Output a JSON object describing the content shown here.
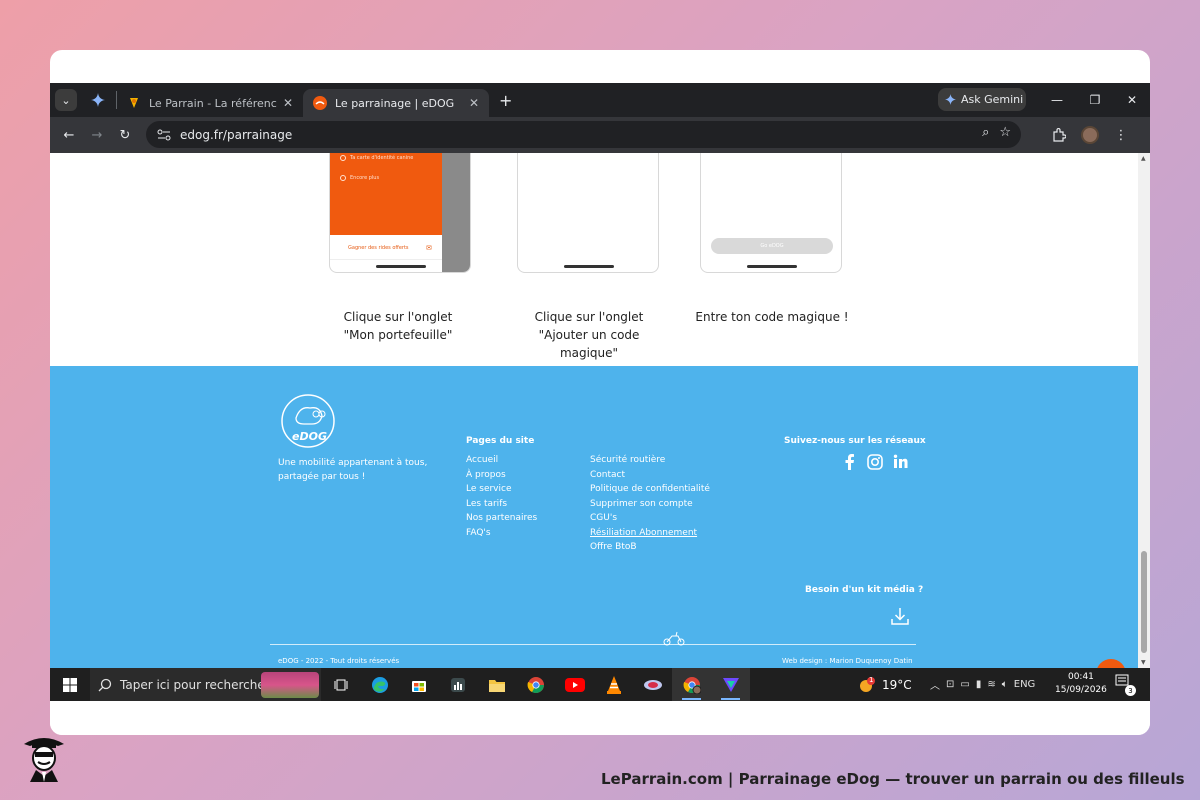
{
  "browser": {
    "tabs": [
      {
        "title": "Le Parrain - La référence du pa",
        "active": false
      },
      {
        "title": "Le parrainage | eDOG",
        "active": true
      }
    ],
    "ask_gemini": "Ask Gemini",
    "url": "edog.fr/parrainage"
  },
  "steps": {
    "phone1": {
      "row1": "Ta carte d'identité canine",
      "row2": "Encore plus",
      "earn": "Gagner des rides offerts"
    },
    "phone3": {
      "pill": "Go eDOG"
    },
    "captions": [
      "Clique sur l'onglet \"Mon portefeuille\"",
      "Clique sur l'onglet \"Ajouter un code magique\"",
      "Entre ton code magique !"
    ]
  },
  "footer": {
    "logo_text": "eDOG",
    "tagline": "Une mobilité appartenant à tous, partagée par tous !",
    "pages_title": "Pages du site",
    "links_col1": [
      "Accueil",
      "À propos",
      "Le service",
      "Les tarifs",
      "Nos partenaires",
      "FAQ's"
    ],
    "links_col2": [
      "Sécurité routière",
      "Contact",
      "Politique de confidentialité",
      "Supprimer son compte",
      "CGU's",
      "Résiliation Abonnement",
      "Offre BtoB"
    ],
    "social_title": "Suivez-nous sur les réseaux",
    "kit_title": "Besoin d'un kit média ?",
    "copyright": "eDOG - 2022 - Tout droits réservés",
    "design_credit": "Web design : Marion Duquenoy Datin"
  },
  "taskbar": {
    "search_placeholder": "Taper ici pour rechercher",
    "weather_temp": "19°C",
    "language": "ENG",
    "time": "00:41",
    "date": "15/09/2026",
    "notification_count": "3",
    "weather_badge": "1"
  },
  "branding": {
    "caption": "LeParrain.com | Parrainage eDog — trouver un parrain ou des filleuls"
  },
  "colors": {
    "footer_blue": "#4eb3ec",
    "edog_orange": "#f05a0f",
    "chrome_dark": "#202124"
  }
}
